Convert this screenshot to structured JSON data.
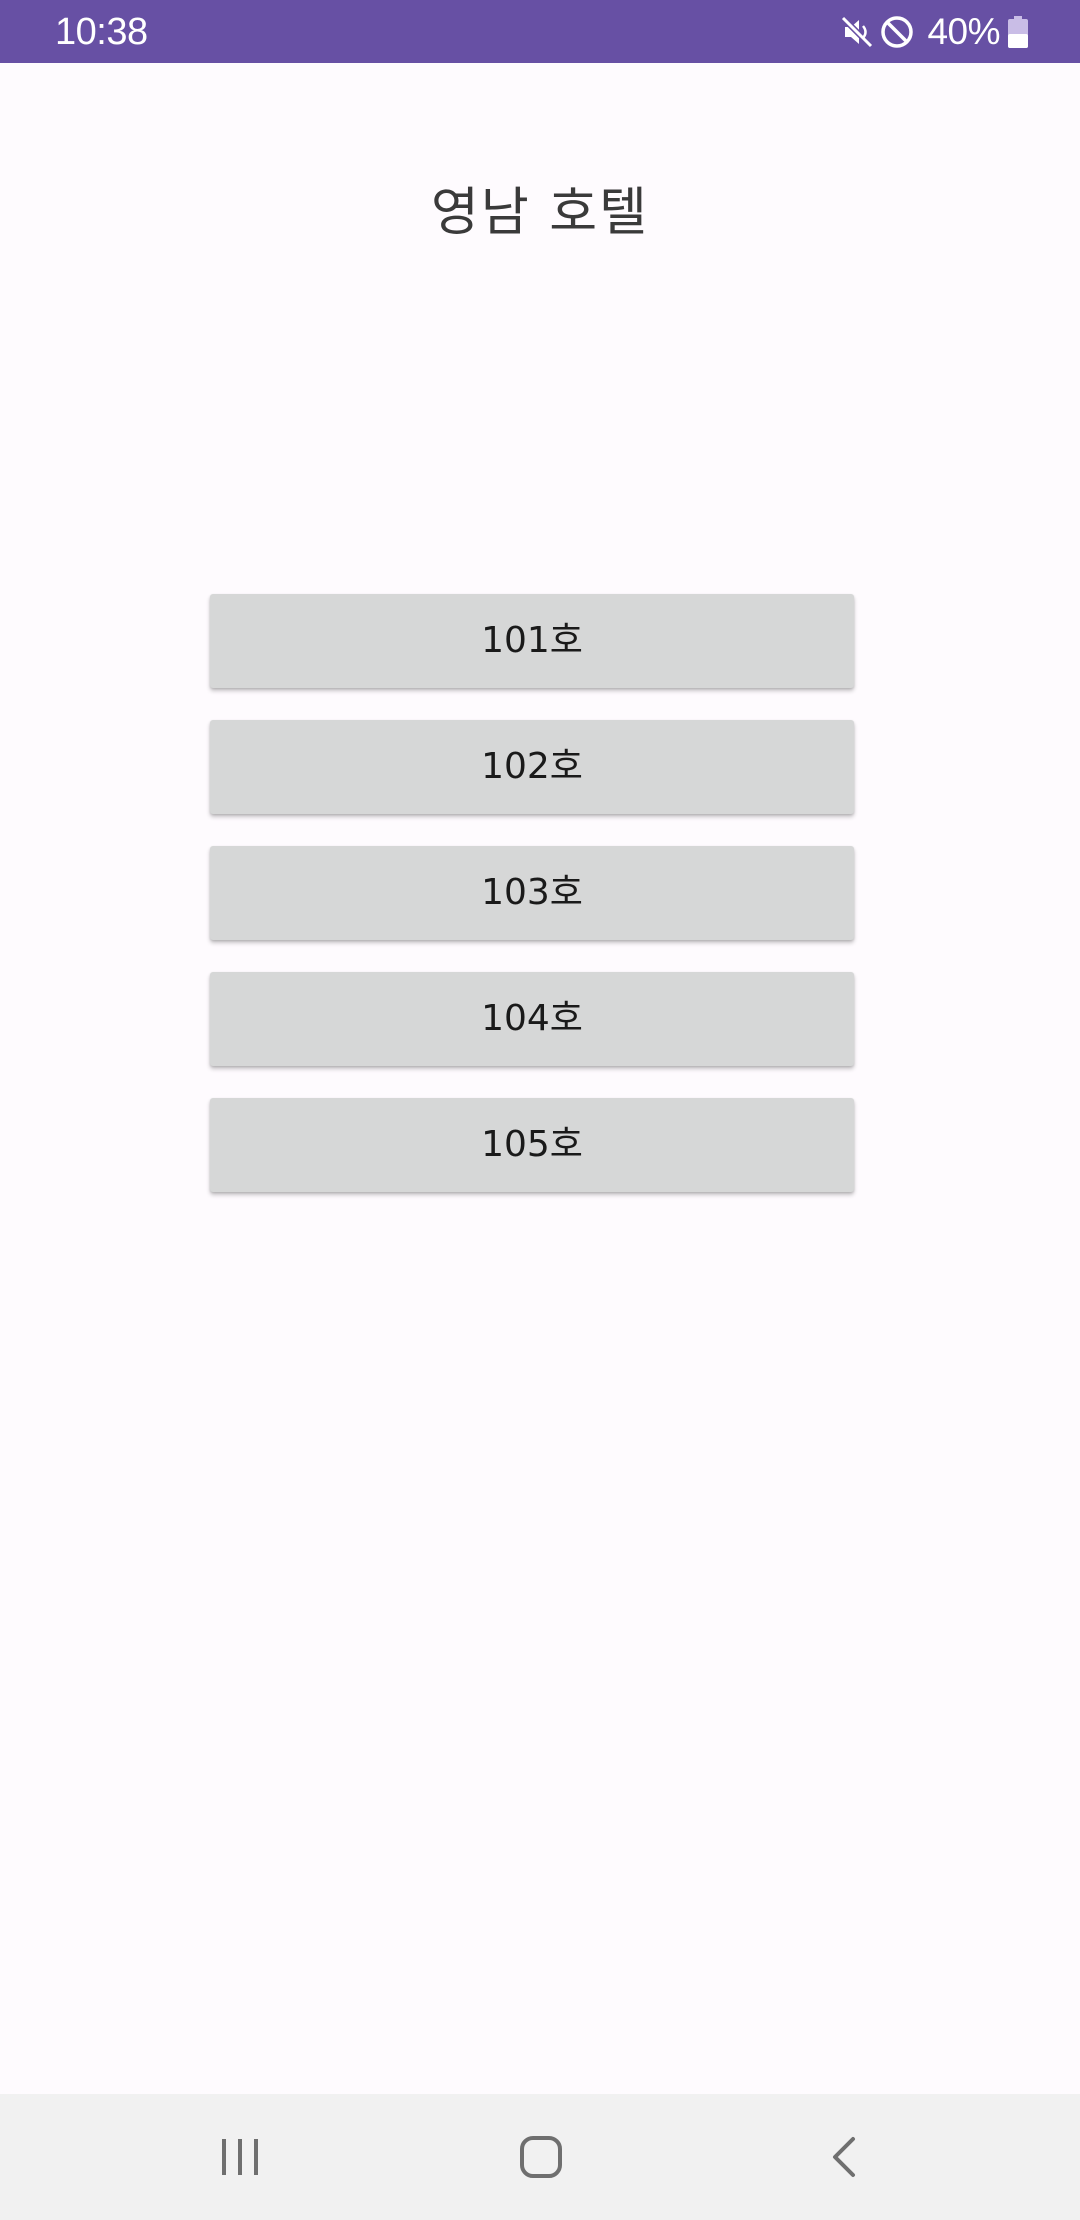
{
  "status_bar": {
    "time": "10:38",
    "battery": "40%",
    "icons": [
      "mute-icon",
      "do-not-disturb-icon",
      "battery-icon"
    ]
  },
  "app": {
    "title": "영남 호텔"
  },
  "rooms": [
    {
      "label": "101호"
    },
    {
      "label": "102호"
    },
    {
      "label": "103호"
    },
    {
      "label": "104호"
    },
    {
      "label": "105호"
    }
  ],
  "nav_bar": {
    "icons": [
      "recent-apps-icon",
      "home-icon",
      "back-icon"
    ]
  },
  "colors": {
    "status_bar": "#6750a4",
    "background": "#fefbfe",
    "button": "#d6d7d7",
    "nav_bar": "#f1f1f1"
  }
}
